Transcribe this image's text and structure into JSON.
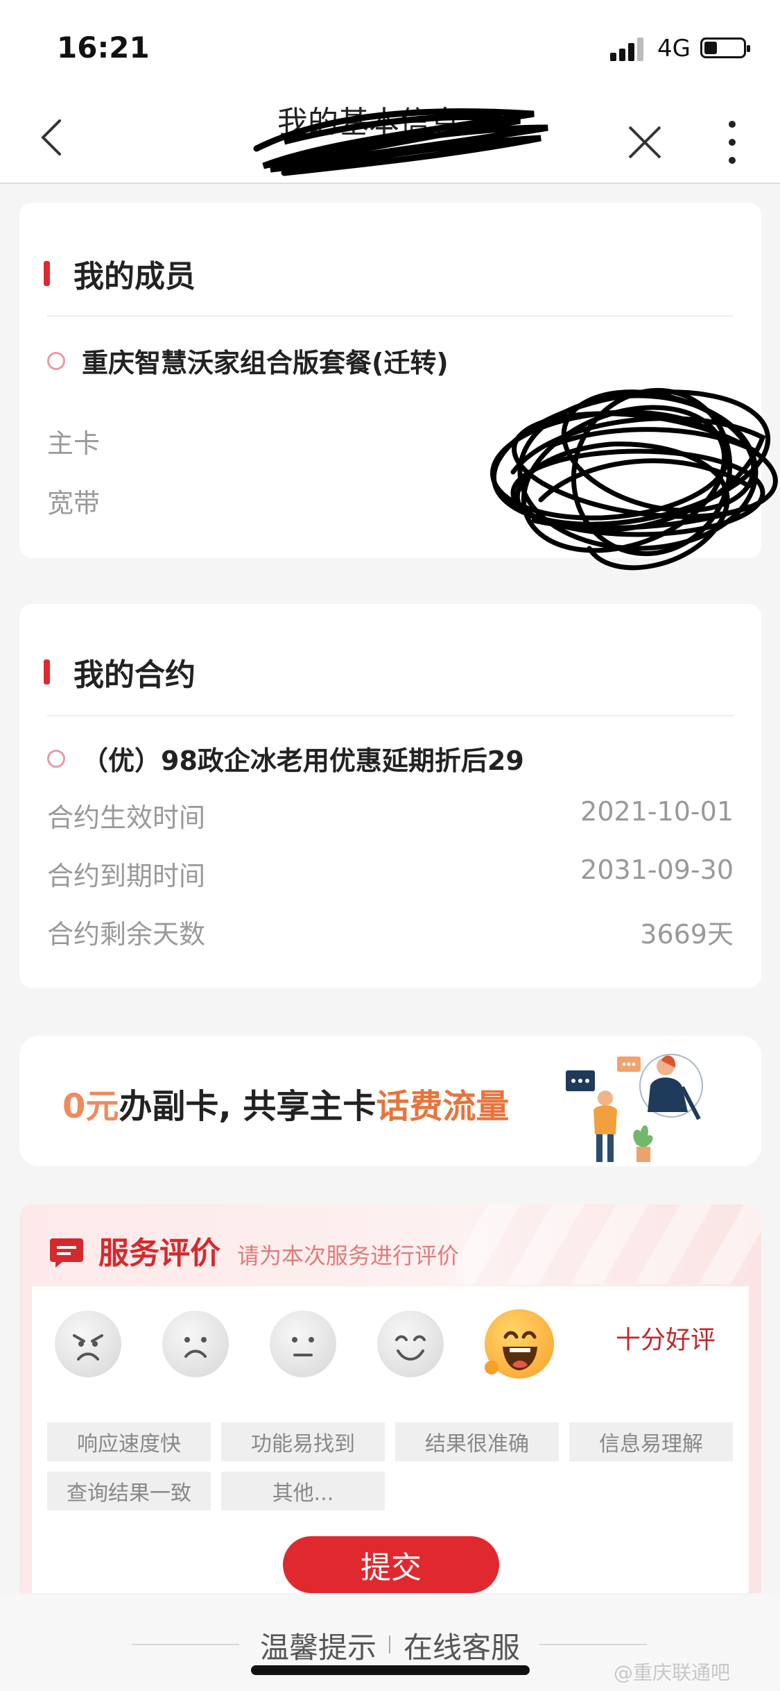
{
  "status_bar": {
    "time": "16:21",
    "network": "4G"
  },
  "nav": {
    "title": "我的基本信息",
    "subtitle": "",
    "back_icon": "chevron-left-icon",
    "close_icon": "close-icon",
    "more_icon": "more-vertical-icon"
  },
  "members": {
    "section_title": "我的成员",
    "plan": "重庆智慧沃家组合版套餐(迁转)",
    "rows": [
      {
        "label": "主卡"
      },
      {
        "label": "宽带"
      }
    ]
  },
  "contract": {
    "section_title": "我的合约",
    "name": "（优）98政企冰老用优惠延期折后29",
    "rows": [
      {
        "label": "合约生效时间",
        "value": "2021-10-01"
      },
      {
        "label": "合约到期时间",
        "value": "2031-09-30"
      },
      {
        "label": "合约剩余天数",
        "value": "3669天"
      }
    ]
  },
  "promo": {
    "part1": "0元",
    "part2": "办副卡, 共享主卡",
    "part3": "话费流量"
  },
  "rating": {
    "title": "服务评价",
    "subtitle": "请为本次服务进行评价",
    "selected_label": "十分好评",
    "faces": [
      "very-unsatisfied",
      "unsatisfied",
      "neutral",
      "satisfied",
      "very-satisfied"
    ],
    "tags": [
      "响应速度快",
      "功能易找到",
      "结果很准确",
      "信息易理解",
      "查询结果一致",
      "其他..."
    ],
    "submit": "提交"
  },
  "footer": {
    "tip": "温馨提示",
    "service": "在线客服",
    "watermark": "@重庆联通吧"
  },
  "colors": {
    "accent": "#e0292f",
    "orange": "#e8743b"
  }
}
